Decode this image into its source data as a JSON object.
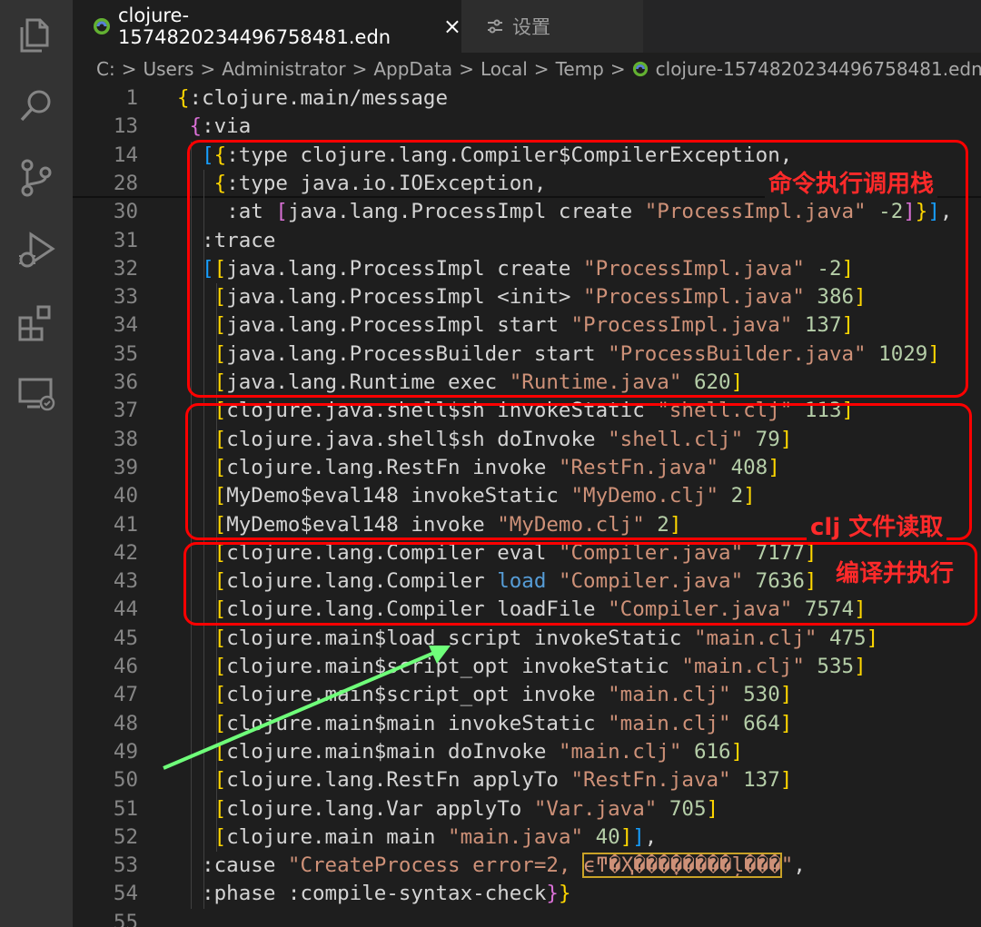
{
  "tabs": [
    {
      "label": "clojure-1574820234496758481.edn",
      "active": true,
      "close": "×"
    },
    {
      "label": "设置",
      "active": false
    }
  ],
  "breadcrumb": {
    "parts": [
      "C:",
      "Users",
      "Administrator",
      "AppData",
      "Local",
      "Temp"
    ],
    "sep": ">",
    "file": "clojure-1574820234496758481.edn"
  },
  "editor": {
    "lines": [
      {
        "n": "1",
        "indent": "",
        "tokens": [
          [
            "{",
            "brace-y"
          ],
          [
            ":clojure.main/message",
            "kw"
          ]
        ]
      },
      {
        "n": "13",
        "indent": " ",
        "tokens": [
          [
            "{",
            "brace-p"
          ],
          [
            ":via",
            "kw"
          ]
        ]
      },
      {
        "n": "14",
        "indent": "  ",
        "tokens": [
          [
            "[",
            "brace-b"
          ],
          [
            "{",
            "brace-y"
          ],
          [
            ":type clojure.lang.Compiler$CompilerException,",
            "kw"
          ]
        ]
      },
      {
        "n": "28",
        "indent": "   ",
        "tokens": [
          [
            "{",
            "brace-y"
          ],
          [
            ":type java.io.IOException,",
            "kw"
          ]
        ]
      },
      {
        "n": "30",
        "indent": "    ",
        "tokens": [
          [
            ":at ",
            "kw"
          ],
          [
            "[",
            "brace-p"
          ],
          [
            "java.lang.ProcessImpl create ",
            "kw"
          ],
          [
            "\"ProcessImpl.java\"",
            "str"
          ],
          [
            " -2",
            "num"
          ],
          [
            "]",
            "brace-p"
          ],
          [
            "}",
            "brace-y"
          ],
          [
            "]",
            "brace-b"
          ],
          [
            ",",
            "kw"
          ]
        ]
      },
      {
        "n": "31",
        "indent": "  ",
        "tokens": [
          [
            ":trace",
            "kw"
          ]
        ]
      },
      {
        "n": "32",
        "indent": "  ",
        "tokens": [
          [
            "[",
            "brace-b"
          ],
          [
            "[",
            "brace-y"
          ],
          [
            "java.lang.ProcessImpl create ",
            "kw"
          ],
          [
            "\"ProcessImpl.java\"",
            "str"
          ],
          [
            " -2",
            "num"
          ],
          [
            "]",
            "brace-y"
          ]
        ]
      },
      {
        "n": "33",
        "indent": "   ",
        "tokens": [
          [
            "[",
            "brace-y"
          ],
          [
            "java.lang.ProcessImpl <init> ",
            "kw"
          ],
          [
            "\"ProcessImpl.java\"",
            "str"
          ],
          [
            " 386",
            "num"
          ],
          [
            "]",
            "brace-y"
          ]
        ]
      },
      {
        "n": "34",
        "indent": "   ",
        "tokens": [
          [
            "[",
            "brace-y"
          ],
          [
            "java.lang.ProcessImpl start ",
            "kw"
          ],
          [
            "\"ProcessImpl.java\"",
            "str"
          ],
          [
            " 137",
            "num"
          ],
          [
            "]",
            "brace-y"
          ]
        ]
      },
      {
        "n": "35",
        "indent": "   ",
        "tokens": [
          [
            "[",
            "brace-y"
          ],
          [
            "java.lang.ProcessBuilder start ",
            "kw"
          ],
          [
            "\"ProcessBuilder.java\"",
            "str"
          ],
          [
            " 1029",
            "num"
          ],
          [
            "]",
            "brace-y"
          ]
        ]
      },
      {
        "n": "36",
        "indent": "   ",
        "tokens": [
          [
            "[",
            "brace-y"
          ],
          [
            "java.lang.Runtime exec ",
            "kw"
          ],
          [
            "\"Runtime.java\"",
            "str"
          ],
          [
            " 620",
            "num"
          ],
          [
            "]",
            "brace-y"
          ]
        ]
      },
      {
        "n": "37",
        "indent": "   ",
        "tokens": [
          [
            "[",
            "brace-y"
          ],
          [
            "clojure.java.shell$sh invokeStatic ",
            "kw"
          ],
          [
            "\"shell.clj\"",
            "str"
          ],
          [
            " 113",
            "num"
          ],
          [
            "]",
            "brace-y"
          ]
        ]
      },
      {
        "n": "38",
        "indent": "   ",
        "tokens": [
          [
            "[",
            "brace-y"
          ],
          [
            "clojure.java.shell$sh doInvoke ",
            "kw"
          ],
          [
            "\"shell.clj\"",
            "str"
          ],
          [
            " 79",
            "num"
          ],
          [
            "]",
            "brace-y"
          ]
        ]
      },
      {
        "n": "39",
        "indent": "   ",
        "tokens": [
          [
            "[",
            "brace-y"
          ],
          [
            "clojure.lang.RestFn invoke ",
            "kw"
          ],
          [
            "\"RestFn.java\"",
            "str"
          ],
          [
            " 408",
            "num"
          ],
          [
            "]",
            "brace-y"
          ]
        ]
      },
      {
        "n": "40",
        "indent": "   ",
        "tokens": [
          [
            "[",
            "brace-y"
          ],
          [
            "MyDemo$eval148 invokeStatic ",
            "kw"
          ],
          [
            "\"MyDemo.clj\"",
            "str"
          ],
          [
            " 2",
            "num"
          ],
          [
            "]",
            "brace-y"
          ]
        ]
      },
      {
        "n": "41",
        "indent": "   ",
        "tokens": [
          [
            "[",
            "brace-y"
          ],
          [
            "MyDemo$eval148 invoke ",
            "kw"
          ],
          [
            "\"MyDemo.clj\"",
            "str"
          ],
          [
            " 2",
            "num"
          ],
          [
            "]",
            "brace-y"
          ]
        ]
      },
      {
        "n": "42",
        "indent": "   ",
        "tokens": [
          [
            "[",
            "brace-y"
          ],
          [
            "clojure.lang.Compiler eval ",
            "kw"
          ],
          [
            "\"Compiler.java\"",
            "str"
          ],
          [
            " 7177",
            "num"
          ],
          [
            "]",
            "brace-y"
          ]
        ]
      },
      {
        "n": "43",
        "indent": "   ",
        "tokens": [
          [
            "[",
            "brace-y"
          ],
          [
            "clojure.lang.Compiler ",
            "kw"
          ],
          [
            "load",
            "blue"
          ],
          [
            " ",
            "kw"
          ],
          [
            "\"Compiler.java\"",
            "str"
          ],
          [
            " 7636",
            "num"
          ],
          [
            "]",
            "brace-y"
          ]
        ]
      },
      {
        "n": "44",
        "indent": "   ",
        "tokens": [
          [
            "[",
            "brace-y"
          ],
          [
            "clojure.lang.Compiler loadFile ",
            "kw"
          ],
          [
            "\"Compiler.java\"",
            "str"
          ],
          [
            " 7574",
            "num"
          ],
          [
            "]",
            "brace-y"
          ]
        ]
      },
      {
        "n": "45",
        "indent": "   ",
        "tokens": [
          [
            "[",
            "brace-y"
          ],
          [
            "clojure.main$load_script invokeStatic ",
            "kw"
          ],
          [
            "\"main.clj\"",
            "str"
          ],
          [
            " 475",
            "num"
          ],
          [
            "]",
            "brace-y"
          ]
        ]
      },
      {
        "n": "46",
        "indent": "   ",
        "tokens": [
          [
            "[",
            "brace-y"
          ],
          [
            "clojure.main$script_opt invokeStatic ",
            "kw"
          ],
          [
            "\"main.clj\"",
            "str"
          ],
          [
            " 535",
            "num"
          ],
          [
            "]",
            "brace-y"
          ]
        ]
      },
      {
        "n": "47",
        "indent": "   ",
        "tokens": [
          [
            "[",
            "brace-y"
          ],
          [
            "clojure.main$script_opt invoke ",
            "kw"
          ],
          [
            "\"main.clj\"",
            "str"
          ],
          [
            " 530",
            "num"
          ],
          [
            "]",
            "brace-y"
          ]
        ]
      },
      {
        "n": "48",
        "indent": "   ",
        "tokens": [
          [
            "[",
            "brace-y"
          ],
          [
            "clojure.main$main invokeStatic ",
            "kw"
          ],
          [
            "\"main.clj\"",
            "str"
          ],
          [
            " 664",
            "num"
          ],
          [
            "]",
            "brace-y"
          ]
        ]
      },
      {
        "n": "49",
        "indent": "   ",
        "tokens": [
          [
            "[",
            "brace-y"
          ],
          [
            "clojure.main$main doInvoke ",
            "kw"
          ],
          [
            "\"main.clj\"",
            "str"
          ],
          [
            " 616",
            "num"
          ],
          [
            "]",
            "brace-y"
          ]
        ]
      },
      {
        "n": "50",
        "indent": "   ",
        "tokens": [
          [
            "[",
            "brace-y"
          ],
          [
            "clojure.lang.RestFn applyTo ",
            "kw"
          ],
          [
            "\"RestFn.java\"",
            "str"
          ],
          [
            " 137",
            "num"
          ],
          [
            "]",
            "brace-y"
          ]
        ]
      },
      {
        "n": "51",
        "indent": "   ",
        "tokens": [
          [
            "[",
            "brace-y"
          ],
          [
            "clojure.lang.Var applyTo ",
            "kw"
          ],
          [
            "\"Var.java\"",
            "str"
          ],
          [
            " 705",
            "num"
          ],
          [
            "]",
            "brace-y"
          ]
        ]
      },
      {
        "n": "52",
        "indent": "   ",
        "tokens": [
          [
            "[",
            "brace-y"
          ],
          [
            "clojure.main main ",
            "kw"
          ],
          [
            "\"main.java\"",
            "str"
          ],
          [
            " 40",
            "num"
          ],
          [
            "]",
            "brace-y"
          ],
          [
            "]",
            "brace-b"
          ],
          [
            ",",
            "kw"
          ]
        ]
      },
      {
        "n": "53",
        "indent": "  ",
        "tokens": [
          [
            ":cause ",
            "kw"
          ],
          [
            "\"CreateProcess error=2, ",
            "str"
          ],
          [
            "ϵͳ�Ҳ���ָ�����ļ���",
            "garble"
          ],
          [
            "\"",
            "str"
          ],
          [
            ",",
            "kw"
          ]
        ]
      },
      {
        "n": "54",
        "indent": "  ",
        "tokens": [
          [
            ":phase :compile-syntax-check",
            "kw"
          ],
          [
            "}",
            "brace-p"
          ],
          [
            "}",
            "brace-y"
          ]
        ]
      },
      {
        "n": "55",
        "indent": "",
        "tokens": []
      }
    ]
  },
  "annotations": {
    "call_stack": "命令执行调用栈",
    "clj_read": "clj 文件读取",
    "compile_exec": "编译并执行"
  },
  "colors": {
    "annotation": "#ff0000",
    "arrow": "#6fff7a"
  }
}
